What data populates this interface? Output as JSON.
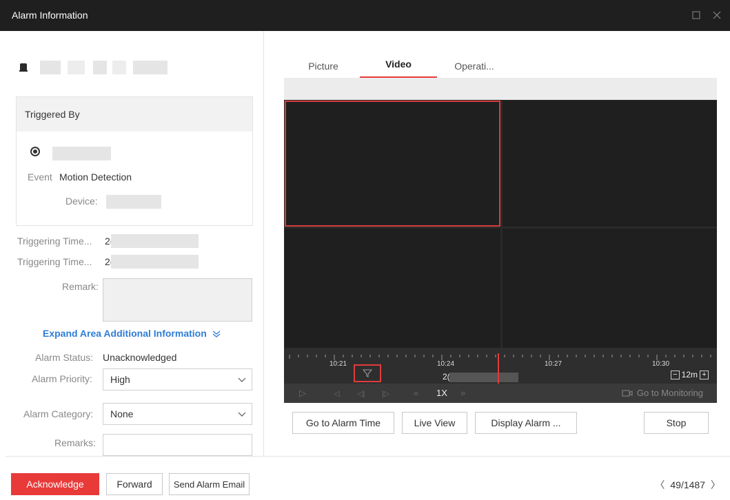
{
  "window": {
    "title": "Alarm Information"
  },
  "left": {
    "triggered_by_heading": "Triggered By",
    "event_label": "Event",
    "event_value": "Motion Detection",
    "device_label": "Device:",
    "triggering_time_label_1": "Triggering Time...",
    "triggering_time_value_1": "2(",
    "triggering_time_label_2": "Triggering Time...",
    "triggering_time_value_2": "2(",
    "remark_label": "Remark:",
    "expand_link": "Expand Area Additional Information",
    "alarm_status_label": "Alarm Status:",
    "alarm_status_value": "Unacknowledged",
    "alarm_priority_label": "Alarm Priority:",
    "alarm_priority_value": "High",
    "alarm_category_label": "Alarm Category:",
    "alarm_category_value": "None",
    "remarks_label": "Remarks:",
    "remarks_value": ""
  },
  "tabs": [
    {
      "label": "Picture",
      "active": false
    },
    {
      "label": "Video",
      "active": true
    },
    {
      "label": "Operati...",
      "active": false
    }
  ],
  "timeline": {
    "labels": [
      "10:21",
      "10:24",
      "10:27",
      "10:30"
    ],
    "date_prefix": "2(",
    "zoom": "12m"
  },
  "playback": {
    "speed": "1X",
    "go_to_monitoring": "Go to Monitoring"
  },
  "video_buttons": {
    "go_to_alarm_time": "Go to Alarm Time",
    "live_view": "Live View",
    "display_alarm": "Display Alarm ...",
    "stop": "Stop"
  },
  "footer": {
    "acknowledge": "Acknowledge",
    "forward": "Forward",
    "send_alarm_email": "Send Alarm Email",
    "pager": "49/1487"
  },
  "colors": {
    "accent_red": "#e93a3a",
    "link_blue": "#2e7dd7",
    "titlebar": "#1f1f1f"
  }
}
